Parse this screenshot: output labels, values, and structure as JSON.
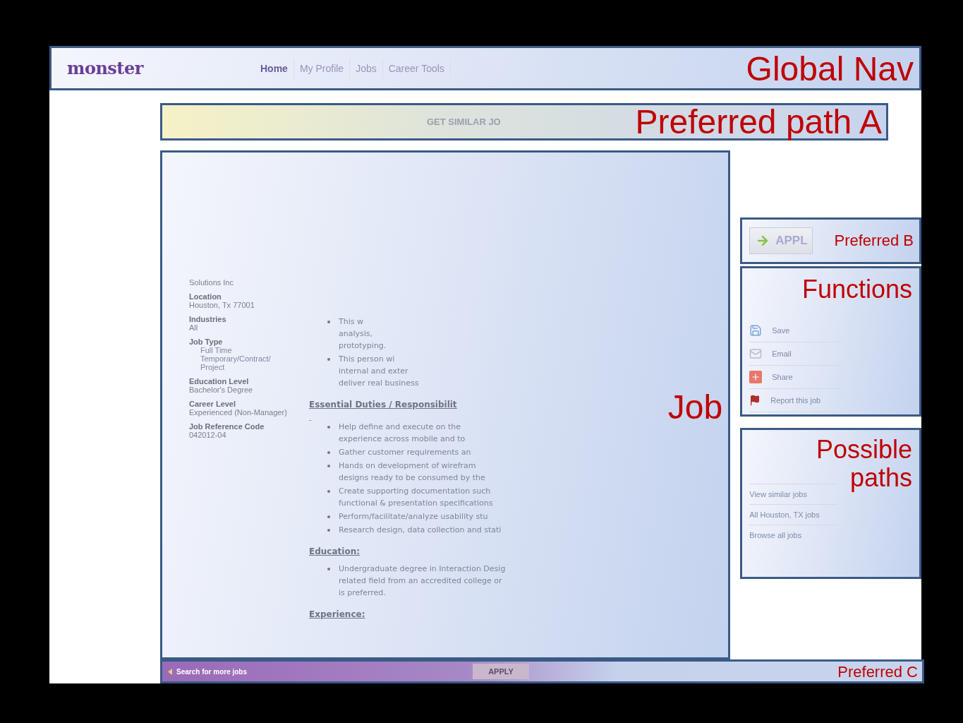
{
  "nav": {
    "logo": "monster",
    "annotation": "Global Nav",
    "items": [
      {
        "label": "Home",
        "selected": true
      },
      {
        "label": "My Profile",
        "selected": false
      },
      {
        "label": "Jobs",
        "selected": false
      },
      {
        "label": "Career Tools",
        "selected": false
      }
    ]
  },
  "similar_bar": {
    "label": "GET SIMILAR JO",
    "annotation": "Preferred path A"
  },
  "job": {
    "annotation": "Job",
    "company": "Solutions Inc",
    "details": [
      {
        "label": "Location",
        "values": [
          "Houston, Tx 77001"
        ]
      },
      {
        "label": "Industries",
        "values": [
          "All"
        ]
      },
      {
        "label": "Job Type",
        "bullets": [
          "Full Time",
          "Temporary/Contract/ Project"
        ]
      },
      {
        "label": "Education Level",
        "values": [
          "Bachelor's Degree"
        ]
      },
      {
        "label": "Career Level",
        "values": [
          "Experienced (Non-Manager)"
        ]
      },
      {
        "label": "Job Reference Code",
        "values": [
          "042012-04"
        ]
      }
    ],
    "intro": [
      [
        "This w",
        "analysis,",
        "prototyping."
      ],
      [
        "This person wi",
        "internal and exter",
        "deliver real business"
      ]
    ],
    "sections": [
      {
        "heading": "Essential Duties / Responsibilit",
        "dash": "-",
        "bullets": [
          [
            "Help define and execute on the",
            "experience across mobile and to"
          ],
          [
            "Gather customer requirements an"
          ],
          [
            "Hands on development of wirefram",
            "designs ready to be consumed by the"
          ],
          [
            "Create supporting documentation such",
            "functional & presentation specifications"
          ],
          [
            "Perform/facilitate/analyze usability stu"
          ],
          [
            "Research design, data collection and stati"
          ]
        ]
      },
      {
        "heading": "Education:",
        "bullets": [
          [
            "Undergraduate degree in Interaction Desig",
            "related field from an accredited college or",
            "is preferred."
          ]
        ]
      },
      {
        "heading": "Experience:"
      }
    ]
  },
  "apply_box": {
    "label": "APPL",
    "annotation": "Preferred B"
  },
  "functions": {
    "annotation": "Functions",
    "items": [
      {
        "kind": "save",
        "label": "Save"
      },
      {
        "kind": "email",
        "label": "Email"
      },
      {
        "kind": "share",
        "label": "Share"
      },
      {
        "kind": "report",
        "label": "Report this job"
      }
    ]
  },
  "paths": {
    "annotation": "Possible paths",
    "items": [
      "View similar jobs",
      "All Houston, TX jobs",
      "Browse all jobs"
    ]
  },
  "bottom_bar": {
    "back": "Search for more jobs",
    "apply": "APPLY",
    "annotation": "Preferred C"
  }
}
